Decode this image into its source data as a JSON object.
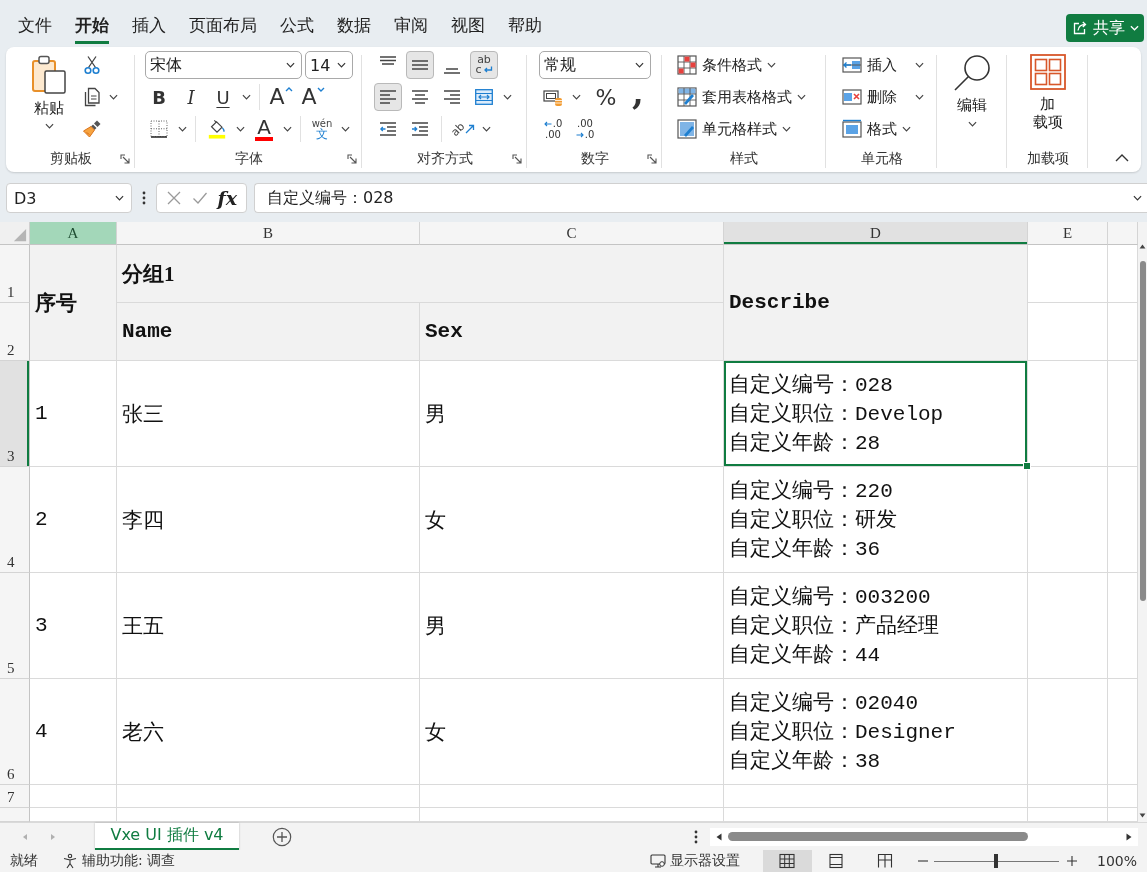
{
  "menu_tabs": [
    {
      "label": "文件",
      "selected": false
    },
    {
      "label": "开始",
      "selected": true
    },
    {
      "label": "插入",
      "selected": false
    },
    {
      "label": "页面布局",
      "selected": false
    },
    {
      "label": "公式",
      "selected": false
    },
    {
      "label": "数据",
      "selected": false
    },
    {
      "label": "审阅",
      "selected": false
    },
    {
      "label": "视图",
      "selected": false
    },
    {
      "label": "帮助",
      "selected": false
    }
  ],
  "share_button": {
    "label": "共享"
  },
  "ribbon": {
    "clipboard": {
      "label": "剪贴板",
      "paste": "粘贴"
    },
    "font": {
      "label": "字体",
      "font_name": "宋体",
      "font_size": "14",
      "style_buttons": [
        {
          "kind": "bold",
          "label": "B"
        },
        {
          "kind": "italic",
          "label": "I"
        },
        {
          "kind": "underline",
          "label": "U"
        }
      ],
      "size_buttons": [
        {
          "kind": "grow",
          "label": "A"
        },
        {
          "kind": "shrink",
          "label": "A"
        }
      ],
      "font_color": "A",
      "phonetic": {
        "top": "wén",
        "bottom": "文"
      }
    },
    "alignment": {
      "label": "对齐方式",
      "rows": [
        {
          "buttons": [
            {
              "kind": "top",
              "selected": false
            },
            {
              "kind": "middle",
              "selected": true
            },
            {
              "kind": "bottom",
              "selected": false
            },
            {
              "kind": "wrap",
              "selected": true,
              "text_top": "ab",
              "text_bottom": "c"
            }
          ]
        },
        {
          "buttons": [
            {
              "kind": "left",
              "selected": true
            },
            {
              "kind": "center",
              "selected": false
            },
            {
              "kind": "right",
              "selected": false
            },
            {
              "kind": "merge",
              "selected": false
            }
          ]
        },
        {
          "buttons": [
            {
              "kind": "outdent",
              "selected": false
            },
            {
              "kind": "indent",
              "selected": false
            },
            {
              "kind": "orientation",
              "selected": false,
              "text": "ab"
            }
          ]
        }
      ]
    },
    "number": {
      "label": "数字",
      "format": "常规",
      "percent": "%",
      "comma": ",",
      "decimals": [
        {
          "kind": "increase",
          "top": ".0",
          "bottom": ".00"
        },
        {
          "kind": "decrease",
          "top": ".00",
          "bottom": ".0"
        }
      ]
    },
    "styles": {
      "label": "样式",
      "items": [
        {
          "kind": "conditional",
          "label": "条件格式"
        },
        {
          "kind": "table",
          "label": "套用表格格式"
        },
        {
          "kind": "cell",
          "label": "单元格样式"
        }
      ]
    },
    "cells": {
      "label": "单元格",
      "items": [
        {
          "kind": "insert",
          "label": "插入"
        },
        {
          "kind": "delete",
          "label": "删除"
        },
        {
          "kind": "format",
          "label": "格式"
        }
      ]
    },
    "editing": {
      "button": "编辑"
    },
    "addins": {
      "label": "加载项",
      "button": "加载项"
    }
  },
  "formula_bar": {
    "name_box": "D3",
    "function_button": "fx",
    "value": "自定义编号：028"
  },
  "sheet": {
    "columns": [
      {
        "letter": "A",
        "highlighted": true,
        "selected": false
      },
      {
        "letter": "B",
        "highlighted": false,
        "selected": false
      },
      {
        "letter": "C",
        "highlighted": false,
        "selected": false
      },
      {
        "letter": "D",
        "highlighted": false,
        "selected": true
      },
      {
        "letter": "E",
        "highlighted": false,
        "selected": false
      }
    ],
    "row_headers": [
      {
        "number": "1",
        "active": false
      },
      {
        "number": "2",
        "active": false
      },
      {
        "number": "3",
        "active": true
      },
      {
        "number": "4",
        "active": false
      },
      {
        "number": "5",
        "active": false
      },
      {
        "number": "6",
        "active": false
      },
      {
        "number": "7",
        "active": false
      }
    ],
    "header": {
      "index": "序号",
      "group": "分组1",
      "name": "Name",
      "sex": "Sex",
      "describe": "Describe"
    },
    "rows": [
      {
        "index": "1",
        "name": "张三",
        "sex": "男",
        "describe": [
          "自定义编号：028",
          "自定义职位：Develop",
          "自定义年龄：28"
        ],
        "selected": true
      },
      {
        "index": "2",
        "name": "李四",
        "sex": "女",
        "describe": [
          "自定义编号：220",
          "自定义职位：研发",
          "自定义年龄：36"
        ],
        "selected": false
      },
      {
        "index": "3",
        "name": "王五",
        "sex": "男",
        "describe": [
          "自定义编号：003200",
          "自定义职位：产品经理",
          "自定义年龄：44"
        ],
        "selected": false
      },
      {
        "index": "4",
        "name": "老六",
        "sex": "女",
        "describe": [
          "自定义编号：02040",
          "自定义职位：Designer",
          "自定义年龄：38"
        ],
        "selected": false
      }
    ]
  },
  "sheet_tabs": [
    {
      "label": "Vxe UI 插件 v4",
      "selected": true
    }
  ],
  "status_bar": {
    "ready": "就绪",
    "accessibility": "辅助功能: 调查",
    "display_settings": "显示器设置",
    "views": [
      {
        "kind": "normal",
        "selected": true
      },
      {
        "kind": "page_layout",
        "selected": false
      },
      {
        "kind": "page_break",
        "selected": false
      }
    ],
    "zoom": {
      "level": 0.5,
      "reading": "100%"
    }
  }
}
